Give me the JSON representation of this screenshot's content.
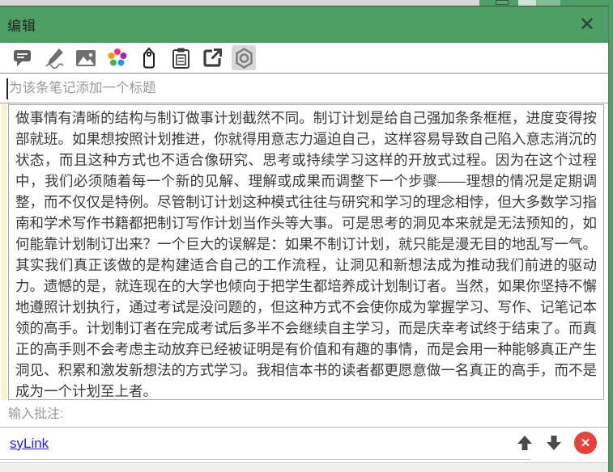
{
  "dialog": {
    "title": "编辑",
    "close_glyph": "✕"
  },
  "toolbar": {
    "icon_names": [
      "comment-icon",
      "pen-icon",
      "image-icon",
      "palette-icon",
      "tag-icon",
      "clipboard-icon",
      "export-icon",
      "nut-icon"
    ],
    "selected_icon": "nut-icon",
    "palette_colors": [
      "#e8317e",
      "#ff9800",
      "#9c27b0",
      "#43b649",
      "#2196f3"
    ]
  },
  "note": {
    "title_placeholder": "为该条笔记添加一个标题",
    "content": "做事情有清晰的结构与制订做事计划截然不同。制订计划是给自己强加条条框框，进度变得按部就班。如果想按照计划推进，你就得用意志力逼迫自己，这样容易导致自己陷入意志消沉的状态，而且这种方式也不适合像研究、思考或持续学习这样的开放式过程。因为在这个过程中，我们必须随着每一个新的见解、理解或成果而调整下一个步骤——理想的情况是定期调整，而不仅仅是特例。尽管制订计划这种模式往往与研究和学习的理念相悖，但大多数学习指南和学术写作书籍都把制订写作计划当作头等大事。可是思考的洞见本来就是无法预知的，如何能靠计划制订出来？一个巨大的误解是：如果不制订计划，就只能是漫无目的地乱写一气。其实我们真正该做的是构建适合自己的工作流程，让洞见和新想法成为推动我们前进的驱动力。遗憾的是，就连现在的大学也倾向于把学生都培养成计划制订者。当然，如果你坚持不懈地遵照计划执行，通过考试是没问题的，但这种方式不会使你成为掌握学习、写作、记笔记本领的高手。计划制订者在完成考试后多半不会继续自主学习，而是庆幸考试终于结束了。而真正的高手则不会考虑主动放弃已经被证明是有价值和有趣的事情，而是会用一种能够真正产生洞见、积累和激发新想法的方式学习。我相信本书的读者都更愿意做一名真正的高手，而不是成为一个计划至上者。",
    "annotation_placeholder": "输入批注:",
    "link_label": "syLink",
    "delete_glyph": "✕"
  },
  "colors": {
    "titlebar_green": "#4f9e66",
    "link_blue": "#2222dd",
    "delete_red": "#e6413a",
    "highlight_yellow": "#fbf1c6"
  }
}
